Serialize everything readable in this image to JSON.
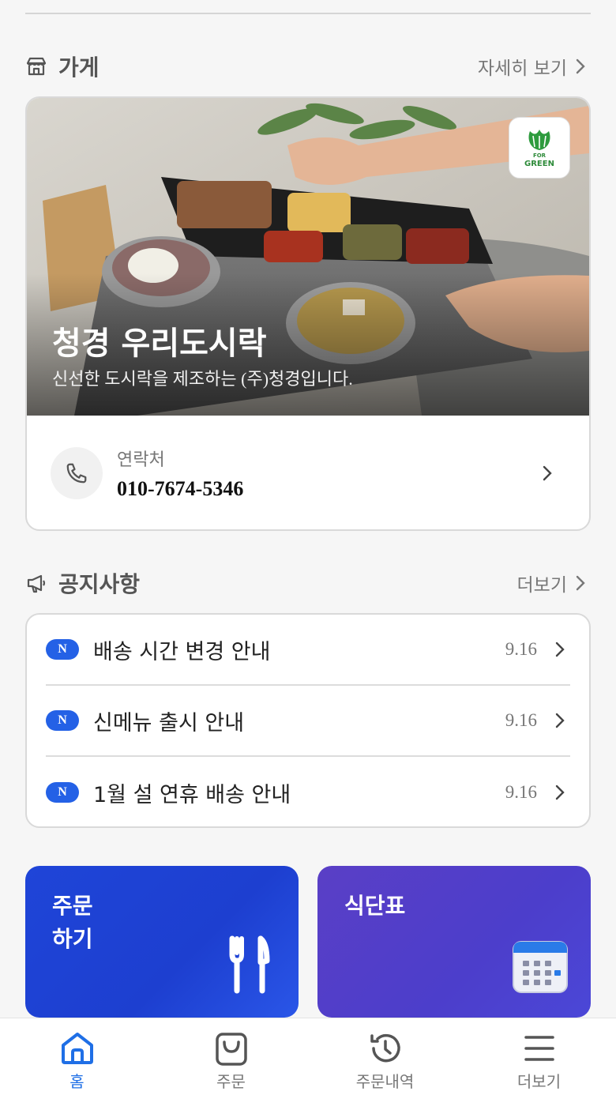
{
  "store_section": {
    "title": "가게",
    "more_label": "자세히 보기",
    "store_name": "청경 우리도시락",
    "store_desc": "신선한 도시락을 제조하는 (주)청경입니다.",
    "logo_text_top": "FOR",
    "logo_text_main": "GREEN",
    "contact_label": "연락처",
    "contact_number": "010-7674-5346"
  },
  "notice_section": {
    "title": "공지사항",
    "more_label": "더보기",
    "items": [
      {
        "badge": "N",
        "title": "배송 시간 변경 안내",
        "date": "9.16"
      },
      {
        "badge": "N",
        "title": "신메뉴 출시 안내",
        "date": "9.16"
      },
      {
        "badge": "N",
        "title": "1월 설 연휴 배송 안내",
        "date": "9.16"
      }
    ]
  },
  "tiles": {
    "order_label": "주문\n하기",
    "menu_label": "식단표"
  },
  "bottom_nav": {
    "items": [
      {
        "label": "홈",
        "icon": "home-icon",
        "active": true
      },
      {
        "label": "주문",
        "icon": "shopping-bag-icon",
        "active": false
      },
      {
        "label": "주문내역",
        "icon": "history-icon",
        "active": false
      },
      {
        "label": "더보기",
        "icon": "menu-icon",
        "active": false
      }
    ]
  },
  "colors": {
    "accent": "#1f6fe6",
    "badge": "#2461e6",
    "order_tile": "#1f45d8",
    "menu_tile": "#4c3ecb"
  }
}
